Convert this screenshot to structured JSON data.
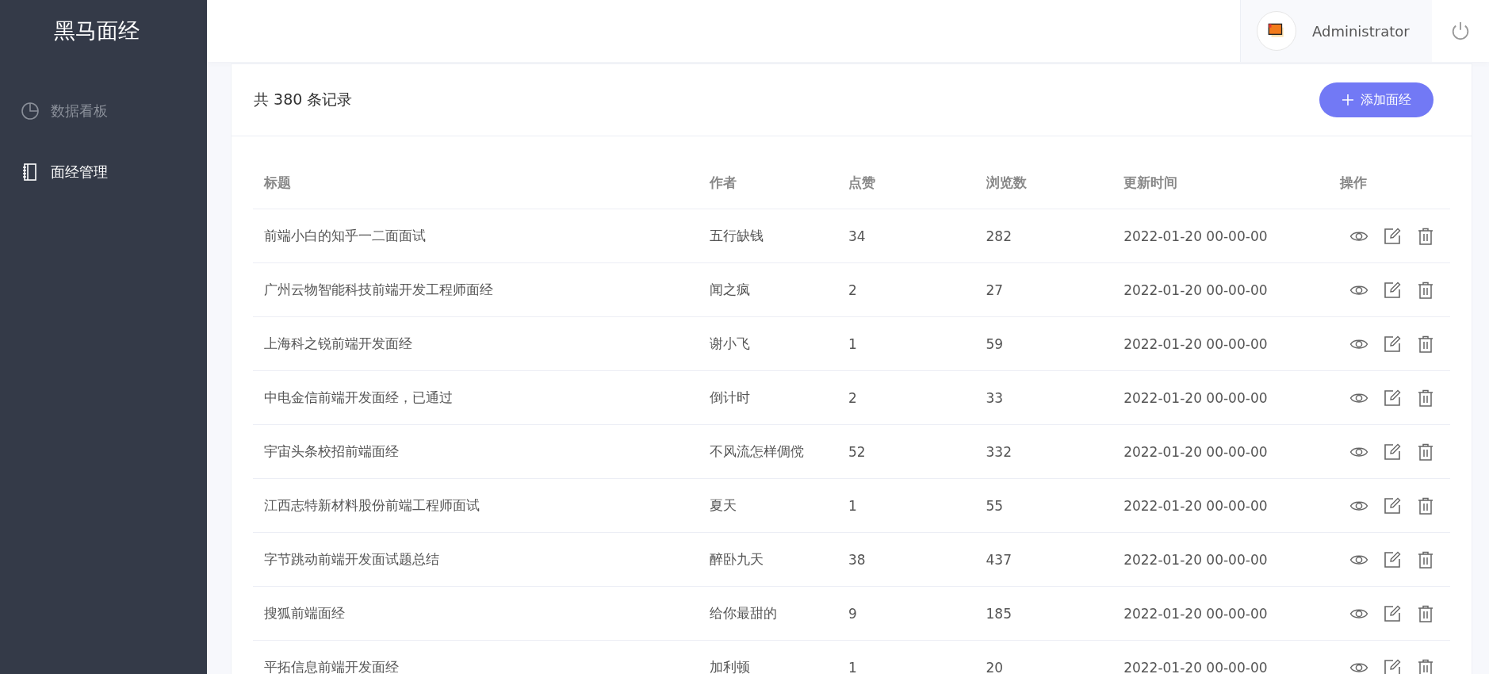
{
  "sidebar": {
    "logo": "黑马面经",
    "items": [
      {
        "label": "数据看板",
        "kind": "chart",
        "selected": false
      },
      {
        "label": "面经管理",
        "kind": "notebook",
        "selected": true
      }
    ]
  },
  "header": {
    "user_name": "Administrator"
  },
  "card": {
    "count_text": "共 380 条记录",
    "add_button": "添加面经"
  },
  "table": {
    "columns": [
      "标题",
      "作者",
      "点赞",
      "浏览数",
      "更新时间",
      "操作"
    ],
    "rows": [
      {
        "title": "前端小白的知乎一二面面试",
        "author": "五行缺钱",
        "likes": "34",
        "views": "282",
        "updated": "2022-01-20 00-00-00"
      },
      {
        "title": "广州云物智能科技前端开发工程师面经",
        "author": "闻之疯",
        "likes": "2",
        "views": "27",
        "updated": "2022-01-20 00-00-00"
      },
      {
        "title": "上海科之锐前端开发面经",
        "author": "谢小飞",
        "likes": "1",
        "views": "59",
        "updated": "2022-01-20 00-00-00"
      },
      {
        "title": "中电金信前端开发面经，已通过",
        "author": "倒计时",
        "likes": "2",
        "views": "33",
        "updated": "2022-01-20 00-00-00"
      },
      {
        "title": "宇宙头条校招前端面经",
        "author": "不风流怎样倜傥",
        "likes": "52",
        "views": "332",
        "updated": "2022-01-20 00-00-00"
      },
      {
        "title": "江西志特新材料股份前端工程师面试",
        "author": "夏天",
        "likes": "1",
        "views": "55",
        "updated": "2022-01-20 00-00-00"
      },
      {
        "title": "字节跳动前端开发面试题总结",
        "author": "醉卧九天",
        "likes": "38",
        "views": "437",
        "updated": "2022-01-20 00-00-00"
      },
      {
        "title": "搜狐前端面经",
        "author": "给你最甜的",
        "likes": "9",
        "views": "185",
        "updated": "2022-01-20 00-00-00"
      },
      {
        "title": "平拓信息前端开发面经",
        "author": "加利顿",
        "likes": "1",
        "views": "20",
        "updated": "2022-01-20 00-00-00"
      }
    ]
  }
}
